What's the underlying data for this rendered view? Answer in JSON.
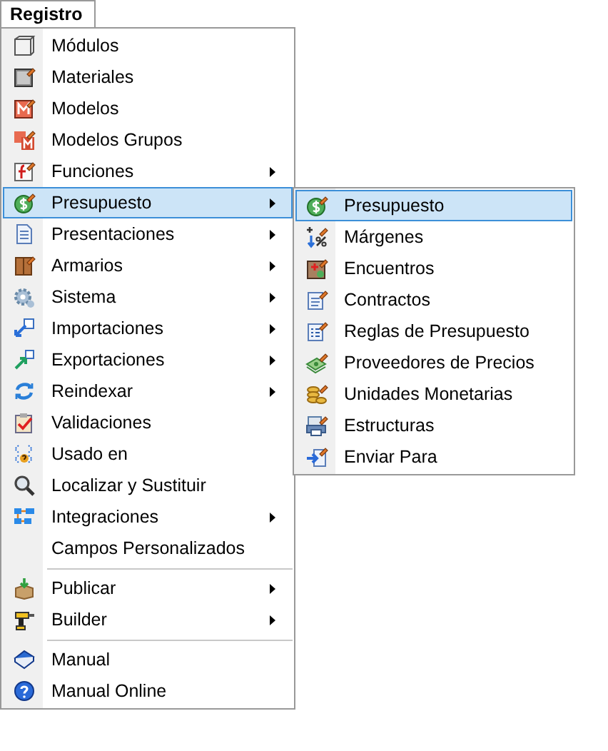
{
  "menu_bar": {
    "title": "Registro"
  },
  "menu": {
    "items": [
      {
        "kind": "item",
        "label": "Módulos",
        "submenu": false,
        "selected": false
      },
      {
        "kind": "item",
        "label": "Materiales",
        "submenu": false,
        "selected": false
      },
      {
        "kind": "item",
        "label": "Modelos",
        "submenu": false,
        "selected": false
      },
      {
        "kind": "item",
        "label": "Modelos Grupos",
        "submenu": false,
        "selected": false
      },
      {
        "kind": "item",
        "label": "Funciones",
        "submenu": true,
        "selected": false
      },
      {
        "kind": "item",
        "label": "Presupuesto",
        "submenu": true,
        "selected": true
      },
      {
        "kind": "item",
        "label": "Presentaciones",
        "submenu": true,
        "selected": false
      },
      {
        "kind": "item",
        "label": "Armarios",
        "submenu": true,
        "selected": false
      },
      {
        "kind": "item",
        "label": "Sistema",
        "submenu": true,
        "selected": false
      },
      {
        "kind": "item",
        "label": "Importaciones",
        "submenu": true,
        "selected": false
      },
      {
        "kind": "item",
        "label": "Exportaciones",
        "submenu": true,
        "selected": false
      },
      {
        "kind": "item",
        "label": "Reindexar",
        "submenu": true,
        "selected": false
      },
      {
        "kind": "item",
        "label": "Validaciones",
        "submenu": false,
        "selected": false
      },
      {
        "kind": "item",
        "label": "Usado en",
        "submenu": false,
        "selected": false
      },
      {
        "kind": "item",
        "label": "Localizar y Sustituir",
        "submenu": false,
        "selected": false
      },
      {
        "kind": "item",
        "label": "Integraciones",
        "submenu": true,
        "selected": false
      },
      {
        "kind": "item",
        "label": "Campos Personalizados",
        "submenu": false,
        "selected": false
      },
      {
        "kind": "separator"
      },
      {
        "kind": "item",
        "label": "Publicar",
        "submenu": true,
        "selected": false
      },
      {
        "kind": "item",
        "label": "Builder",
        "submenu": true,
        "selected": false
      },
      {
        "kind": "separator"
      },
      {
        "kind": "item",
        "label": "Manual",
        "submenu": false,
        "selected": false
      },
      {
        "kind": "item",
        "label": "Manual Online",
        "submenu": false,
        "selected": false
      }
    ]
  },
  "submenu": {
    "items": [
      {
        "kind": "item",
        "label": "Presupuesto",
        "selected": true
      },
      {
        "kind": "item",
        "label": "Márgenes",
        "selected": false
      },
      {
        "kind": "item",
        "label": "Encuentros",
        "selected": false
      },
      {
        "kind": "item",
        "label": "Contractos",
        "selected": false
      },
      {
        "kind": "item",
        "label": "Reglas de Presupuesto",
        "selected": false
      },
      {
        "kind": "item",
        "label": "Proveedores de Precios",
        "selected": false
      },
      {
        "kind": "item",
        "label": "Unidades Monetarias",
        "selected": false
      },
      {
        "kind": "item",
        "label": "Estructuras",
        "selected": false
      },
      {
        "kind": "item",
        "label": "Enviar Para",
        "selected": false
      }
    ]
  }
}
